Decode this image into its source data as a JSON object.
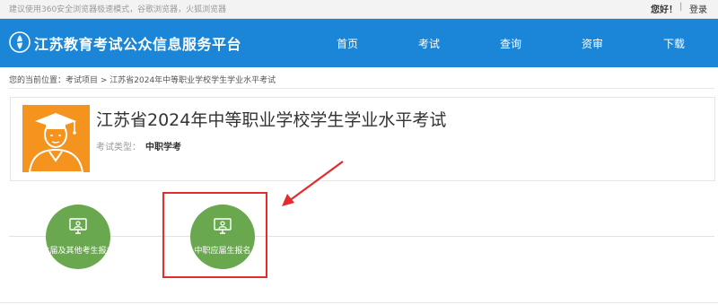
{
  "topbar": {
    "notice": "建议使用360安全浏览器极速模式，谷歌浏览器，火狐浏览器",
    "greeting": "您好！",
    "separator": "|",
    "login": "登录"
  },
  "header": {
    "site_title": "江苏教育考试公众信息服务平台",
    "nav": [
      "首页",
      "考试",
      "查询",
      "资审",
      "下载"
    ],
    "color": "#1b86d7"
  },
  "breadcrumb": "您的当前位置：考试项目 > 江苏省2024年中等职业学校学生学业水平考试",
  "exam": {
    "title": "江苏省2024年中等职业学校学生学业水平考试",
    "type_label": "考试类型：",
    "type_value": "中职学考",
    "avatar": "graduate-avatar-icon",
    "avatar_color": "#f5931f"
  },
  "entries": [
    {
      "label": "往届及其他考生报名",
      "icon": "monitor-user-icon"
    },
    {
      "label": "中职应届生报名",
      "icon": "monitor-user-icon"
    }
  ],
  "entry_color": "#6aa84f",
  "annotation_color": "#e52b2b"
}
